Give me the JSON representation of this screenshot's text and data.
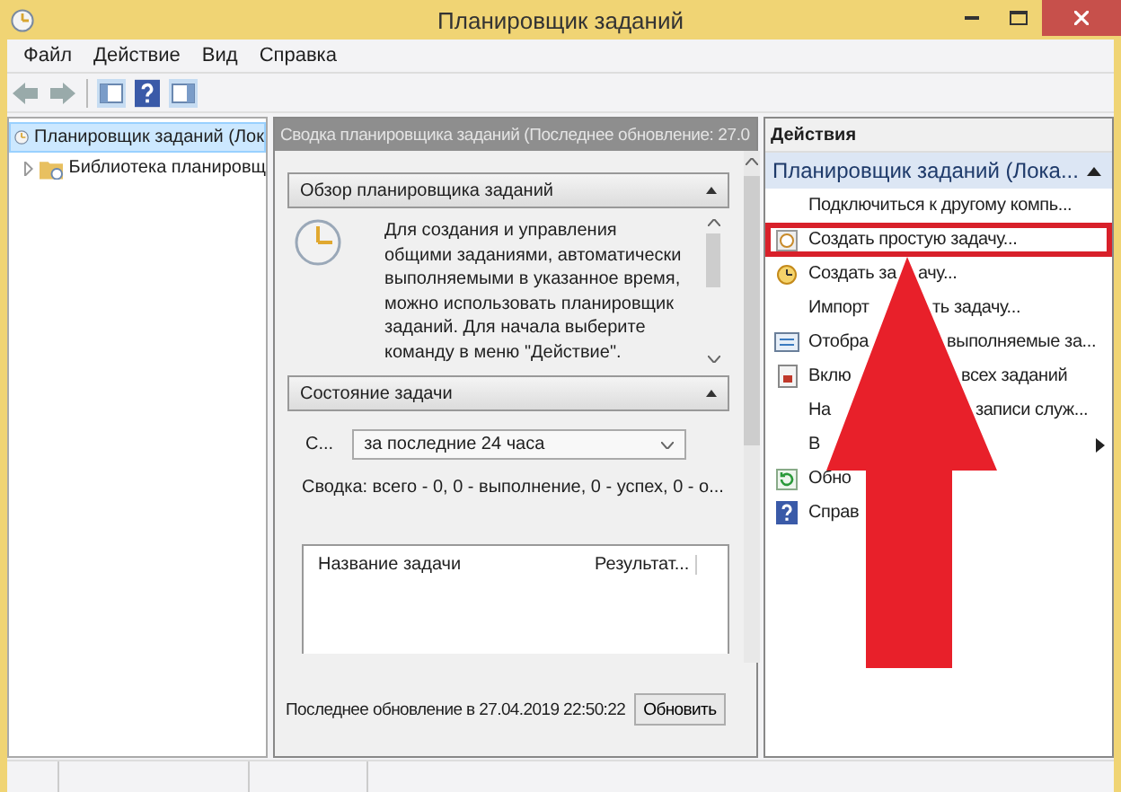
{
  "window": {
    "title": "Планировщик заданий"
  },
  "menu": [
    "Файл",
    "Действие",
    "Вид",
    "Справка"
  ],
  "tree": [
    {
      "label": "Планировщик заданий (Лок",
      "selected": true,
      "children": [
        {
          "label": "Библиотека планировщ",
          "selected": false,
          "expanded": false
        }
      ]
    }
  ],
  "summary": {
    "title": "Сводка планировщика заданий (Последнее обновление: 27.0",
    "overview": {
      "title": "Обзор планировщика заданий",
      "text": "Для создания и управления общими заданиями, автоматически выполняемыми в указанное время, можно использовать планировщик заданий. Для начала выберите команду в меню \"Действие\"."
    },
    "status": {
      "title": "Состояние задачи",
      "filter_label": "С...",
      "filter_value": "за последние 24 часа",
      "summary": "Сводка: всего - 0, 0 - выполнение, 0 - успех, 0 - о...",
      "table": {
        "columns": [
          "Название задачи",
          "Результат..."
        ]
      }
    },
    "last_updated": "Последнее обновление в 27.04.2019 22:50:22",
    "refresh_button": "Обновить"
  },
  "actions": {
    "title": "Действия",
    "group": "Планировщик заданий (Лока...",
    "items": [
      {
        "kind": "plain",
        "highlighted": false,
        "texts": [
          "Подключиться к другому компь..."
        ]
      },
      {
        "kind": "wizard",
        "highlighted": true,
        "texts": [
          "Создать простую задачу..."
        ]
      },
      {
        "kind": "task",
        "highlighted": false,
        "texts": [
          "Создать за",
          "ачу..."
        ]
      },
      {
        "kind": "plain",
        "highlighted": false,
        "texts": [
          "Импорт",
          "ть задачу..."
        ]
      },
      {
        "kind": "display",
        "highlighted": false,
        "texts": [
          "Отобра",
          "выполняемые за..."
        ]
      },
      {
        "kind": "enable",
        "highlighted": false,
        "texts": [
          "Вклю",
          "всех заданий"
        ]
      },
      {
        "kind": "plain",
        "highlighted": false,
        "texts": [
          "На",
          "записи служ..."
        ]
      },
      {
        "kind": "submenu",
        "highlighted": false,
        "texts": [
          "В"
        ]
      },
      {
        "kind": "refresh",
        "highlighted": false,
        "texts": [
          "Обно"
        ]
      },
      {
        "kind": "help",
        "highlighted": false,
        "texts": [
          "Справ"
        ]
      }
    ]
  }
}
